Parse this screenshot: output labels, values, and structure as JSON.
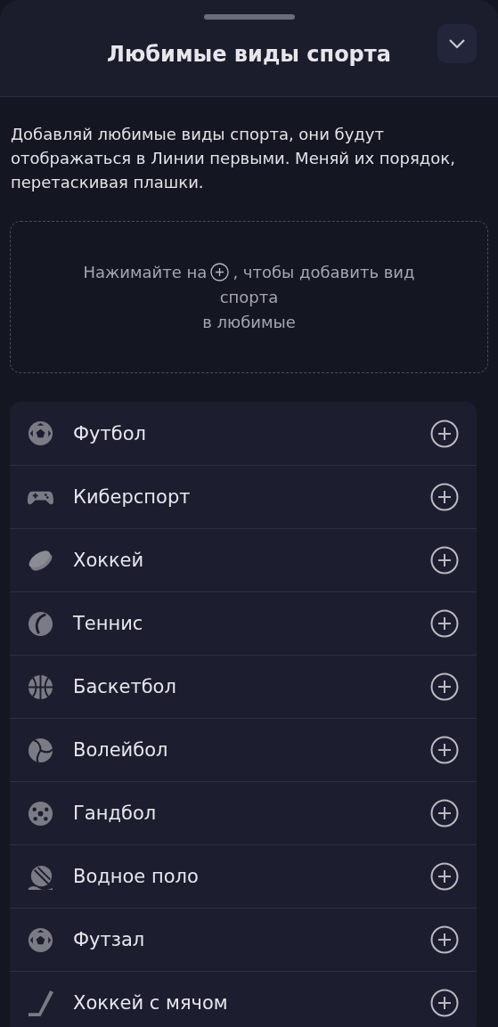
{
  "title": "Любимые виды спорта",
  "description": "Добавляй любимые виды спорта, они будут отображаться в Линии первыми. Меняй их порядок, перетаскивая плашки.",
  "hint": [
    "Нажимайте на",
    ", чтобы добавить вид",
    "спорта",
    "в любимые"
  ],
  "sports": [
    {
      "name": "Футбол",
      "kind": "soccer"
    },
    {
      "name": "Киберспорт",
      "kind": "gamepad"
    },
    {
      "name": "Хоккей",
      "kind": "puck"
    },
    {
      "name": "Теннис",
      "kind": "tennis"
    },
    {
      "name": "Баскетбол",
      "kind": "basketball"
    },
    {
      "name": "Волейбол",
      "kind": "volleyball"
    },
    {
      "name": "Гандбол",
      "kind": "handball"
    },
    {
      "name": "Водное поло",
      "kind": "waterpolo"
    },
    {
      "name": "Футзал",
      "kind": "soccer"
    },
    {
      "name": "Хоккей с мячом",
      "kind": "stick"
    }
  ]
}
